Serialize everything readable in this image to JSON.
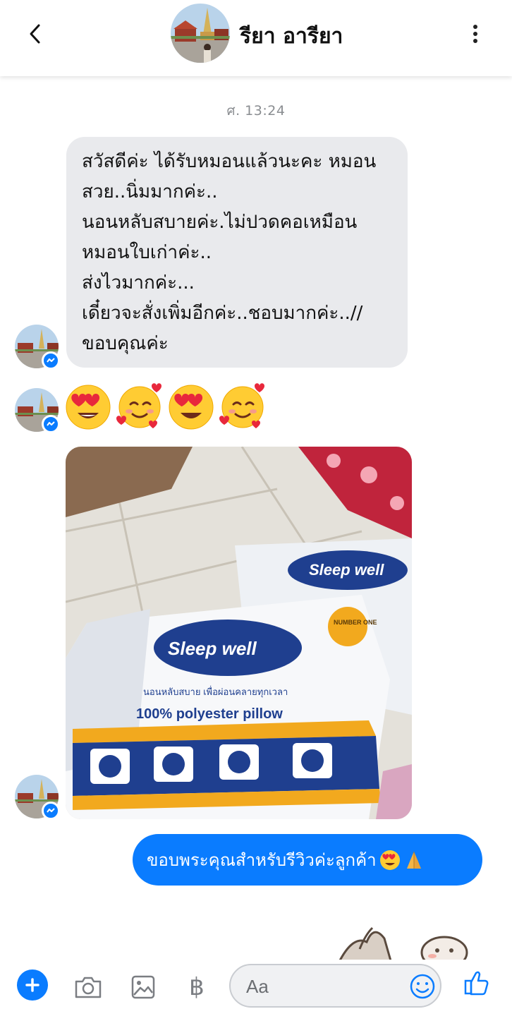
{
  "header": {
    "contact_name": "รียา อารียา",
    "back_icon": "chevron-left-icon",
    "more_icon": "more-vertical-icon"
  },
  "conversation": {
    "timestamp": "ศ. 13:24",
    "incoming_text_lines": [
      "สวัสดีค่ะ ได้รับหมอนแล้วนะคะ หมอน",
      "สวย..นิ่มมากค่ะ..",
      "นอนหลับสบายค่ะ.ไม่ปวดคอเหมือน",
      "หมอนใบเก่าค่ะ..",
      "ส่งไวมากค่ะ...",
      "เดี๋ยวจะสั่งเพิ่มอีกค่ะ..ชอบมากค่ะ..//",
      "ขอบคุณค่ะ"
    ],
    "emoji_message": [
      "heart-eyes",
      "smiling-face-with-hearts",
      "heart-eyes",
      "smiling-face-with-hearts"
    ],
    "photo": {
      "brand": "Sleep well",
      "badge": "NUMBER ONE",
      "subtitle": "นอนหลับสบาย เพื่อผ่อนคลายทุกเวลา",
      "product": "100% polyester pillow"
    },
    "outgoing_text": "ขอบพระคุณสำหรับรีวิวค่ะลูกค้า"
  },
  "composer": {
    "placeholder": "Aa",
    "baht_symbol": "฿"
  },
  "colors": {
    "accent": "#0a7cff",
    "incoming_bubble": "#e9eaed",
    "timestamp": "#8a8d91"
  }
}
